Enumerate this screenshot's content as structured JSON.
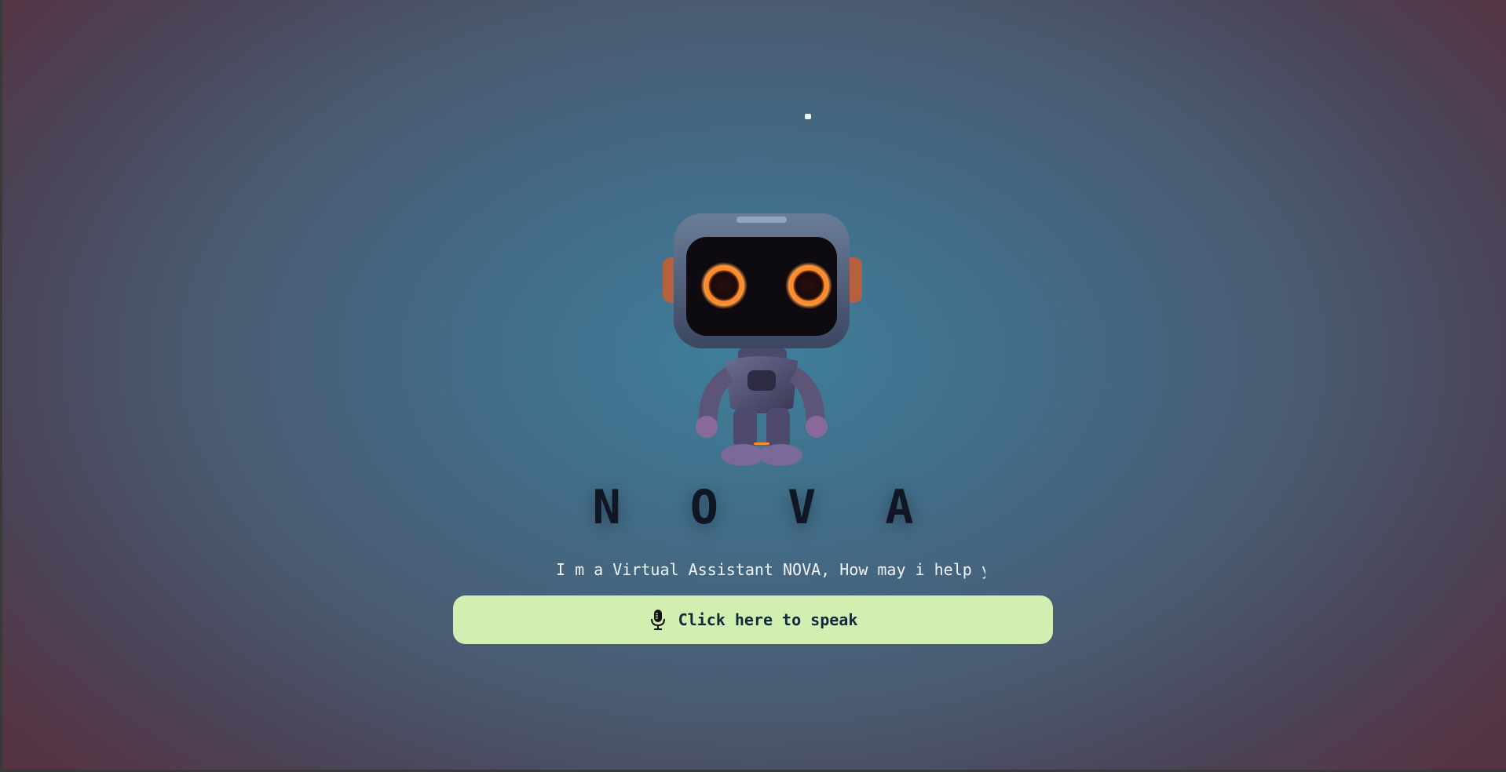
{
  "app": {
    "title": "N O V A",
    "intro_text": "I m a Virtual Assistant NOVA, How may i help y"
  },
  "speak_button": {
    "label": "Click here to speak",
    "icon": "microphone-icon"
  },
  "hero_image": "robot-mascot-illustration",
  "colors": {
    "button_bg": "#d1efb1",
    "title_text": "#0f1624",
    "eye_glow": "#ff7a1a"
  }
}
